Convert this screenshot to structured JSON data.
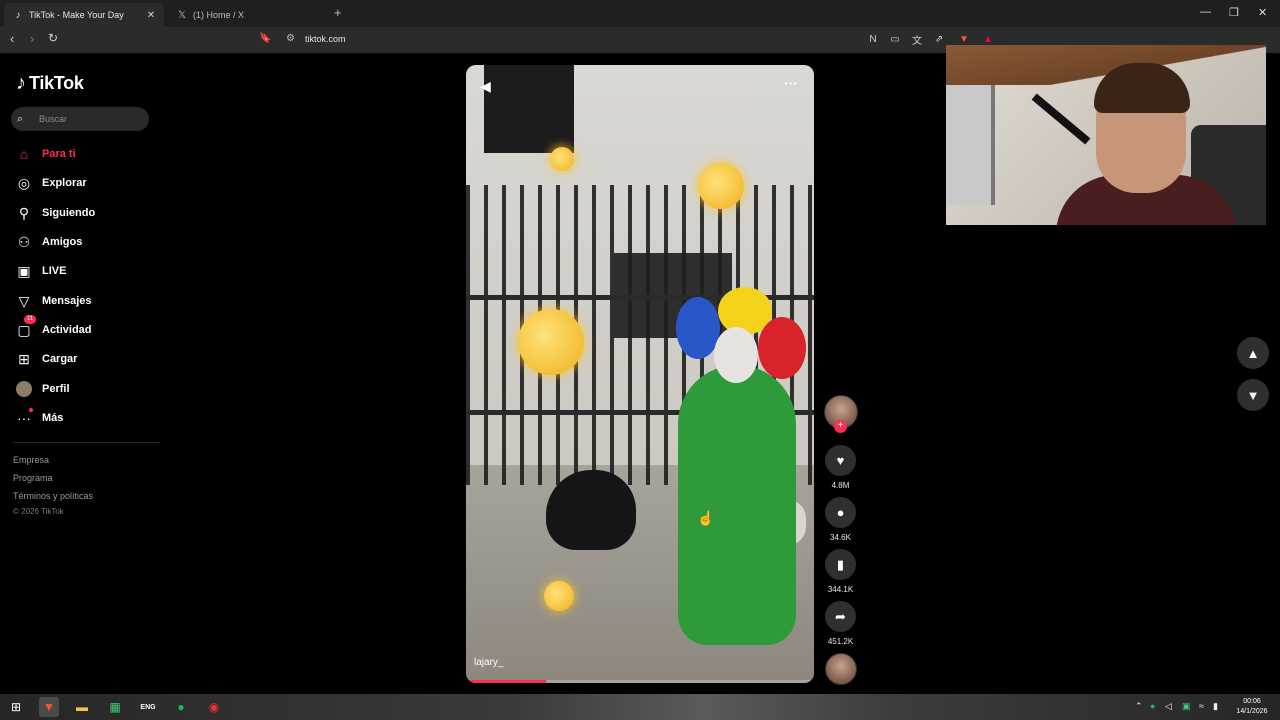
{
  "browser": {
    "tabs": [
      {
        "title": "TikTok - Make Your Day",
        "icon": "tiktok-icon"
      },
      {
        "title": "(1) Home / X",
        "icon": "x-icon"
      }
    ],
    "new_tab": "+",
    "url": "tiktok.com"
  },
  "sidebar": {
    "logo": "TikTok",
    "search_placeholder": "Buscar",
    "items": [
      {
        "label": "Para ti",
        "icon": "home-icon",
        "active": true
      },
      {
        "label": "Explorar",
        "icon": "compass-icon"
      },
      {
        "label": "Siguiendo",
        "icon": "following-icon"
      },
      {
        "label": "Amigos",
        "icon": "friends-icon"
      },
      {
        "label": "LIVE",
        "icon": "live-icon"
      },
      {
        "label": "Mensajes",
        "icon": "messages-icon"
      },
      {
        "label": "Actividad",
        "icon": "activity-icon",
        "badge": "11"
      },
      {
        "label": "Cargar",
        "icon": "upload-icon"
      },
      {
        "label": "Perfil",
        "icon": "profile-avatar"
      },
      {
        "label": "Más",
        "icon": "more-icon"
      }
    ],
    "footer": [
      "Empresa",
      "Programa",
      "Términos y políticas"
    ],
    "copyright": "© 2026 TikTok"
  },
  "video": {
    "username": "lajary_",
    "progress_fraction": 0.23
  },
  "actions": {
    "likes": "4.8M",
    "comments": "34.6K",
    "saves": "344.1K",
    "shares": "451.2K"
  },
  "taskbar": {
    "time": "00:06",
    "date": "14/1/2026",
    "lang": "ENG"
  },
  "colors": {
    "accent": "#fe2c55",
    "background": "#000000"
  }
}
